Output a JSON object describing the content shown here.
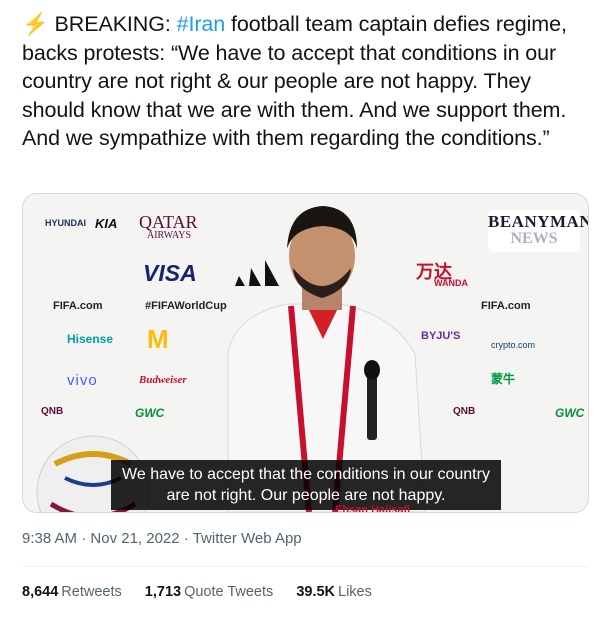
{
  "tweet": {
    "icon": "lightning-emoji",
    "breaking": "BREAKING: ",
    "hashtag": "#Iran",
    "text": " football team captain defies regime, backs protests: “We have to accept that conditions in our country are not right & our people are not happy. They should know that we are with them. And we support them. And we sympathize with them regarding the conditions.”"
  },
  "media": {
    "watermark_line1": "BEANYMAN",
    "watermark_line2": "NEWS",
    "subtitle_line1": "We have to accept that the conditions in our country",
    "subtitle_line2": "are not right. Our people are not happy.",
    "speaker_caption": "Ehsan Hajisafi",
    "sponsors": {
      "hyundai": "HYUNDAI",
      "kia": "KIA",
      "qatar": "QATAR",
      "qatar_sub": "AIRWAYS",
      "visa": "VISA",
      "wanda": "万达",
      "wanda_sub": "WANDA",
      "fifa_com": "FIFA.com",
      "fifa_hashtag": "#FIFAWorldCup",
      "hisense": "Hisense",
      "byjus": "BYJU'S",
      "crypto": "crypto.com",
      "vivo": "vivo",
      "budweiser": "Budweiser",
      "qnb": "QNB",
      "gwc": "GWC",
      "mengniu": "蒙牛"
    }
  },
  "meta": {
    "time": "9:38 AM",
    "sep1": " · ",
    "date": "Nov 21, 2022",
    "sep2": " · ",
    "source": "Twitter Web App"
  },
  "stats": {
    "retweets_count": "8,644",
    "retweets_label": "Retweets",
    "quotes_count": "1,713",
    "quotes_label": "Quote Tweets",
    "likes_count": "39.5K",
    "likes_label": "Likes"
  },
  "colors": {
    "link": "#1d9bf0",
    "text": "#0f1419",
    "muted": "#536471",
    "lightning": "#f4b400"
  }
}
